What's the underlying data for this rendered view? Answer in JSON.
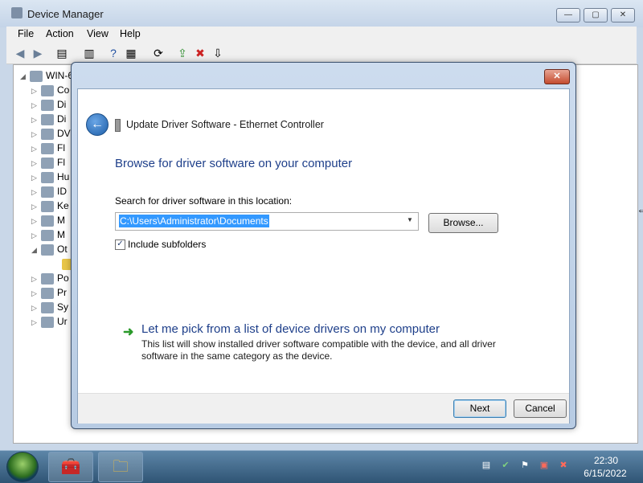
{
  "dm": {
    "title": "Device Manager",
    "menu": [
      "File",
      "Action",
      "View",
      "Help"
    ],
    "tree_root": "WIN-6",
    "tree_items": [
      {
        "label": "Co",
        "expanded": false
      },
      {
        "label": "Di",
        "expanded": false
      },
      {
        "label": "Di",
        "expanded": false
      },
      {
        "label": "DV",
        "expanded": false
      },
      {
        "label": "Fl",
        "expanded": false
      },
      {
        "label": "Fl",
        "expanded": false
      },
      {
        "label": "Hu",
        "expanded": false
      },
      {
        "label": "ID",
        "expanded": false
      },
      {
        "label": "Ke",
        "expanded": false
      },
      {
        "label": "M",
        "expanded": false
      },
      {
        "label": "M",
        "expanded": false
      },
      {
        "label": "Ot",
        "expanded": true
      },
      {
        "label": "",
        "expanded": false
      },
      {
        "label": "Po",
        "expanded": false
      },
      {
        "label": "Pr",
        "expanded": false
      },
      {
        "label": "Sy",
        "expanded": false
      },
      {
        "label": "Ur",
        "expanded": false
      }
    ],
    "caption_buttons": {
      "minimize": "—",
      "maximize": "▢",
      "close": "✕"
    }
  },
  "dialog": {
    "title": "Update Driver Software - Ethernet Controller",
    "close_label": "✕",
    "heading": "Browse for driver software on your computer",
    "search_label": "Search for driver software in this location:",
    "path_value": "C:\\Users\\Administrator\\Documents",
    "browse_label": "Browse...",
    "include_subfolders_label": "Include subfolders",
    "include_subfolders_checked": true,
    "pick_title": "Let me pick from a list of device drivers on my computer",
    "pick_desc": "This list will show installed driver software compatible with the device, and all driver software in the same category as the device.",
    "next_label": "Next",
    "cancel_label": "Cancel"
  },
  "taskbar": {
    "clock_time": "22:30",
    "clock_date": "6/15/2022"
  },
  "colors": {
    "accent_link": "#1e3f8a",
    "selection": "#3399ff",
    "close_red": "#c44b2e"
  }
}
